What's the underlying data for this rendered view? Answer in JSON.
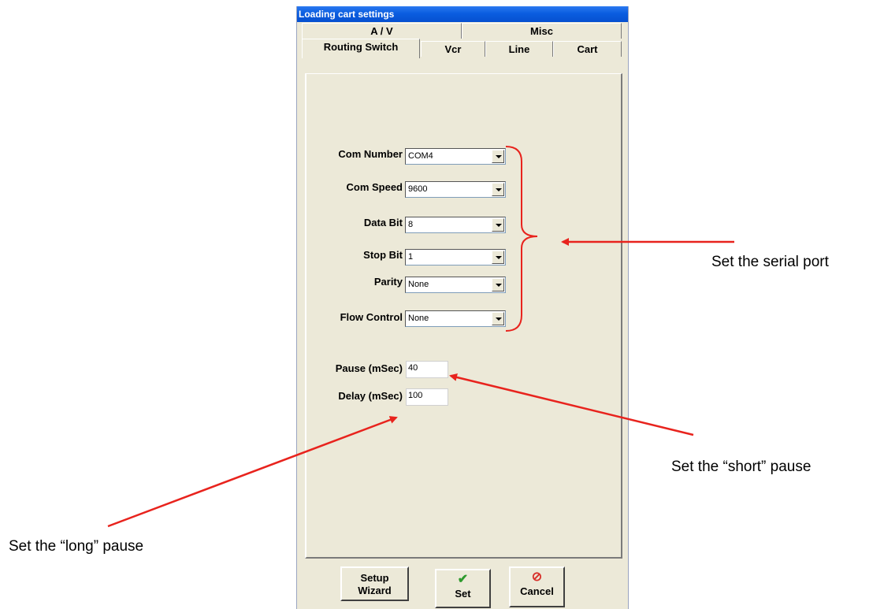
{
  "window": {
    "title": "Loading cart settings"
  },
  "tabs": {
    "back_row": [
      "A / V",
      "Misc"
    ],
    "front_row": [
      "Routing Switch",
      "Vcr",
      "Line",
      "Cart"
    ],
    "active": "Routing Switch"
  },
  "fields": {
    "com_number": {
      "label": "Com Number",
      "value": "COM4"
    },
    "com_speed": {
      "label": "Com Speed",
      "value": "9600"
    },
    "data_bit": {
      "label": "Data Bit",
      "value": "8"
    },
    "stop_bit": {
      "label": "Stop Bit",
      "value": "1"
    },
    "parity": {
      "label": "Parity",
      "value": "None"
    },
    "flow_control": {
      "label": "Flow Control",
      "value": "None"
    },
    "pause": {
      "label": "Pause (mSec)",
      "value": "40"
    },
    "delay": {
      "label": "Delay (mSec)",
      "value": "100"
    }
  },
  "buttons": {
    "setup_wizard": [
      "Setup",
      "Wizard"
    ],
    "set": "Set",
    "cancel": "Cancel"
  },
  "annotations": {
    "serial_port": "Set the serial port",
    "short_pause": "Set the “short” pause",
    "long_pause": "Set the “long” pause"
  },
  "colors": {
    "title_bar": "#0a5de0",
    "dialog_face": "#ece9d8",
    "annotation": "#e8231d",
    "checkmark": "#2d9a2d",
    "cancel_icon": "#d8302a"
  },
  "icons": {
    "set": "green-checkmark-icon",
    "cancel": "red-no-entry-icon",
    "dropdown": "chevron-down-icon"
  }
}
